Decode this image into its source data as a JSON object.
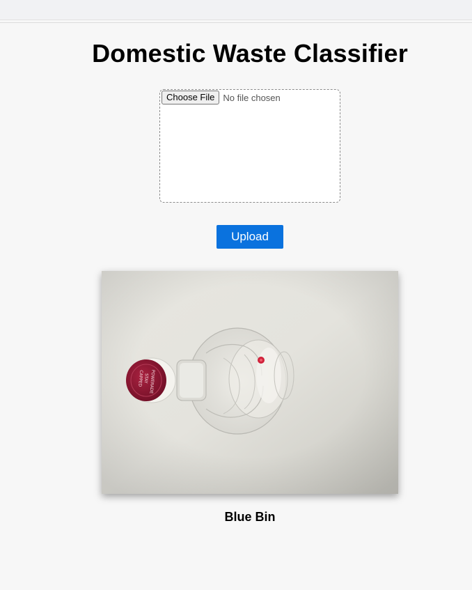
{
  "header": {
    "title": "Domestic Waste Classifier"
  },
  "upload_form": {
    "choose_file_label": "Choose File",
    "file_status": "No file chosen",
    "upload_label": "Upload"
  },
  "result": {
    "image_description_icon": "plastic-bottle-photo",
    "label": "Blue Bin"
  },
  "colors": {
    "accent": "#0a72de",
    "cap": "#8b1430"
  }
}
